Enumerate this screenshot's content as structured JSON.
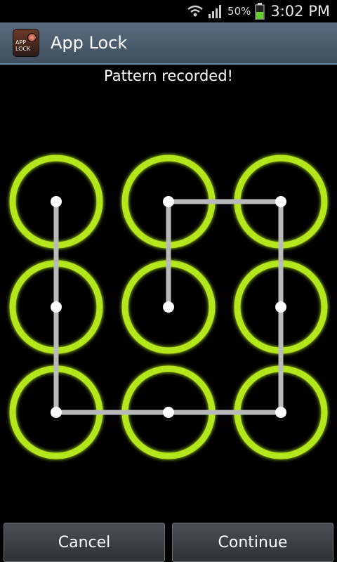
{
  "status_bar": {
    "wifi_icon": "wifi-icon",
    "signal_icon": "signal-bars-icon",
    "battery_percent": "50%",
    "battery_icon": "battery-charging-icon",
    "time": "3:02 PM"
  },
  "title_bar": {
    "app_icon": "app-lock-icon",
    "app_icon_text": "APP LOCK",
    "title": "App Lock"
  },
  "message": "Pattern recorded!",
  "pattern": {
    "grid_rows": 3,
    "grid_cols": 3,
    "ring_color": "#b4e61e",
    "path_color": "#b9b9b9",
    "dot_color": "#ffffff",
    "recorded_sequence": [
      5,
      2,
      3,
      6,
      9,
      8,
      7,
      4,
      1
    ]
  },
  "buttons": {
    "cancel": "Cancel",
    "continue": "Continue"
  }
}
